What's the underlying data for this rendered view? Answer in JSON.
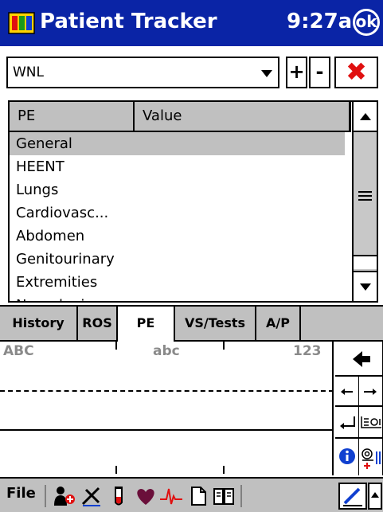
{
  "titlebar": {
    "title": "Patient Tracker",
    "time": "9:27a",
    "ok_label": "ok"
  },
  "combo": {
    "value": "WNL"
  },
  "buttons": {
    "plus": "+",
    "minus": "-",
    "delete": "✖"
  },
  "grid": {
    "headers": {
      "pe": "PE",
      "value": "Value"
    },
    "rows": [
      {
        "pe": "General",
        "selected": true
      },
      {
        "pe": "HEENT"
      },
      {
        "pe": "Lungs"
      },
      {
        "pe": "Cardiovasc..."
      },
      {
        "pe": "Abdomen"
      },
      {
        "pe": "Genitourinary"
      },
      {
        "pe": "Extremities"
      },
      {
        "pe": "Neurologic"
      }
    ]
  },
  "tabs": [
    {
      "label": "History"
    },
    {
      "label": "ROS"
    },
    {
      "label": "PE",
      "active": true
    },
    {
      "label": "VS/Tests"
    },
    {
      "label": "A/P"
    }
  ],
  "input_panel": {
    "labels": {
      "upper": "ABC",
      "lower": "abc",
      "numbers": "123"
    }
  },
  "cmdbar": {
    "file_label": "File",
    "tools": [
      "add-patient-icon",
      "procedure-icon",
      "test-tube-icon",
      "heart-icon",
      "ecg-icon",
      "document-icon",
      "book-icon"
    ]
  },
  "colors": {
    "titlebar": "#0a24a6",
    "panel": "#c0c0c0",
    "selection": "#c0c0c0",
    "delete": "#e01010"
  }
}
